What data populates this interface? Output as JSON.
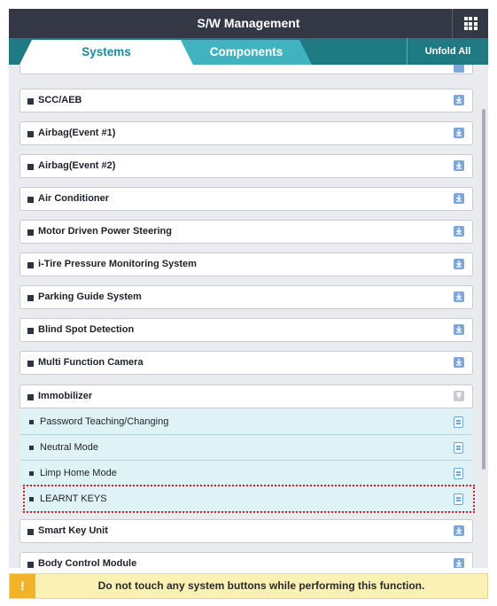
{
  "header": {
    "title": "S/W Management",
    "menu_icon": "grid-icon"
  },
  "tabs": [
    {
      "label": "Systems",
      "active": true
    },
    {
      "label": "Components",
      "active": false
    }
  ],
  "actions": {
    "unfold_all": "Unfold All"
  },
  "systems": [
    {
      "label": "SCC/AEB",
      "icon": "download-icon"
    },
    {
      "label": "Airbag(Event #1)",
      "icon": "download-icon"
    },
    {
      "label": "Airbag(Event #2)",
      "icon": "download-icon"
    },
    {
      "label": "Air Conditioner",
      "icon": "download-icon"
    },
    {
      "label": "Motor Driven Power Steering",
      "icon": "download-icon"
    },
    {
      "label": "i-Tire Pressure Monitoring System",
      "icon": "download-icon"
    },
    {
      "label": "Parking Guide System",
      "icon": "download-icon"
    },
    {
      "label": "Blind Spot Detection",
      "icon": "download-icon"
    },
    {
      "label": "Multi Function Camera",
      "icon": "download-icon"
    },
    {
      "label": "Immobilizer",
      "icon": "upload-icon",
      "expanded": true
    },
    {
      "label": "Smart Key Unit",
      "icon": "download-icon"
    },
    {
      "label": "Body Control Module",
      "icon": "download-icon"
    }
  ],
  "immobilizer_functions": [
    {
      "label": "Password Teaching/Changing",
      "icon": "document-icon"
    },
    {
      "label": "Neutral Mode",
      "icon": "document-icon"
    },
    {
      "label": "Limp Home Mode",
      "icon": "document-icon"
    },
    {
      "label": "LEARNT KEYS",
      "icon": "document-icon",
      "highlighted": true
    }
  ],
  "notice": {
    "icon": "!",
    "message": "Do not touch any system buttons while performing this function."
  },
  "colors": {
    "title_bar": "#333844",
    "tab_bar": "#1e7a83",
    "active_tab_text": "#1c8aa0",
    "inactive_tab": "#3fb4c0",
    "sub_item_bg": "#dff3f7",
    "highlight_border": "#e01b1b",
    "notice_bg": "#fbf1b5",
    "warning": "#f2b32b"
  }
}
